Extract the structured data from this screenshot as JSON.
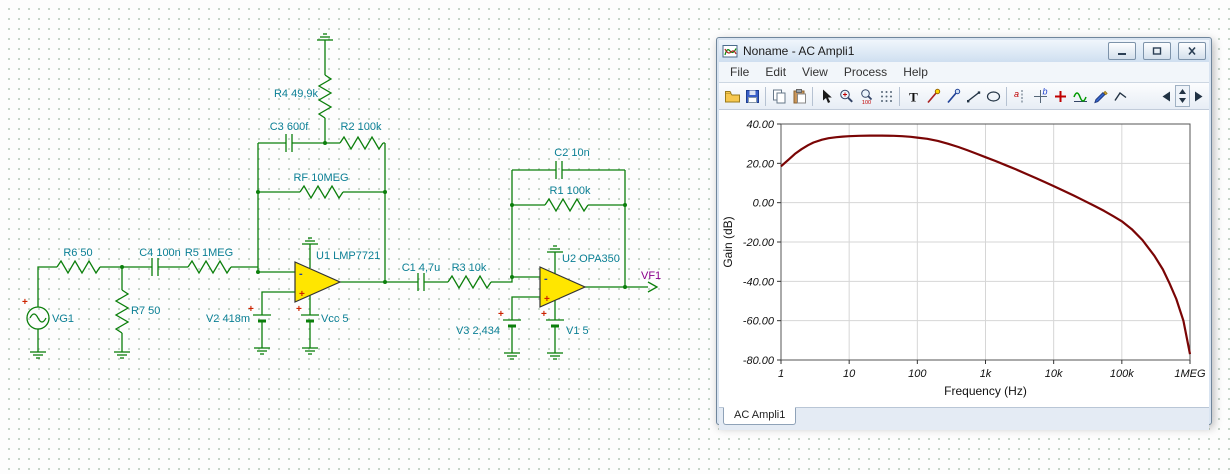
{
  "schematic": {
    "plus": "+",
    "minus": "-",
    "components": {
      "vg1": "VG1",
      "r6": "R6 50",
      "c4": "C4 100n",
      "r5": "R5 1MEG",
      "r7": "R7 50",
      "r4": "R4 49,9k",
      "c3": "C3 600f",
      "r2": "R2 100k",
      "rf": "RF 10MEG",
      "u1": "U1 LMP7721",
      "v2": "V2 418m",
      "vcc": "Vcc 5",
      "c1": "C1 4,7u",
      "r3": "R3 10k",
      "u2": "U2 OPA350",
      "c2": "C2 10n",
      "r1": "R1 100k",
      "v3": "V3 2,434",
      "v1": "V1 5",
      "vf1": "VF1"
    },
    "colors": {
      "wire": "#0c7f0c",
      "label": "#0b7f95",
      "output_label": "#8a008a",
      "opamp_fill": "#ffe600"
    }
  },
  "window": {
    "title": "Noname - AC Ampli1",
    "menu": [
      "File",
      "Edit",
      "View",
      "Process",
      "Help"
    ],
    "tab": "AC Ampli1",
    "toolbar_icons": [
      "open",
      "save",
      "copy",
      "paste",
      "select",
      "zoom-in",
      "zoom-100",
      "grid",
      "text",
      "probe-red",
      "probe-blue",
      "line",
      "ellipse",
      "cursor-a",
      "cursor-b",
      "add-marker",
      "waveform",
      "pen",
      "corner",
      "prev",
      "spinner",
      "next"
    ]
  },
  "toolbar": {
    "zoom_level_label": "100",
    "text_tool_label": "T",
    "cursor_a_label": "a",
    "cursor_b_label": "b"
  },
  "chart_data": {
    "type": "line",
    "title": "",
    "xlabel": "Frequency (Hz)",
    "ylabel": "Gain (dB)",
    "x_scale": "log",
    "xlim": [
      1,
      1000000
    ],
    "ylim": [
      -80,
      40
    ],
    "x_ticks": [
      "1",
      "10",
      "100",
      "1k",
      "10k",
      "100k",
      "1MEG"
    ],
    "x_tick_values": [
      1,
      10,
      100,
      1000,
      10000,
      100000,
      1000000
    ],
    "y_ticks": [
      "40.00",
      "20.00",
      "0.00",
      "-20.00",
      "-40.00",
      "-60.00",
      "-80.00"
    ],
    "y_tick_values": [
      40,
      20,
      0,
      -20,
      -40,
      -60,
      -80
    ],
    "grid": true,
    "legend": "none",
    "series": [
      {
        "name": "Gain",
        "color": "#7a0505",
        "points": [
          [
            1,
            18.5
          ],
          [
            1.3,
            22
          ],
          [
            1.6,
            24.8
          ],
          [
            2,
            27.2
          ],
          [
            2.5,
            29.2
          ],
          [
            3,
            30.6
          ],
          [
            4,
            32
          ],
          [
            5,
            32.8
          ],
          [
            6.5,
            33.3
          ],
          [
            8,
            33.6
          ],
          [
            10,
            33.8
          ],
          [
            14,
            34
          ],
          [
            20,
            34.1
          ],
          [
            30,
            34.1
          ],
          [
            45,
            34
          ],
          [
            60,
            33.8
          ],
          [
            80,
            33.5
          ],
          [
            100,
            33.1
          ],
          [
            140,
            32.5
          ],
          [
            200,
            31.4
          ],
          [
            280,
            30
          ],
          [
            400,
            28.3
          ],
          [
            550,
            26.6
          ],
          [
            750,
            24.8
          ],
          [
            1000,
            23.1
          ],
          [
            1400,
            21.2
          ],
          [
            2000,
            19
          ],
          [
            2800,
            16.9
          ],
          [
            4000,
            14.6
          ],
          [
            5500,
            12.5
          ],
          [
            7500,
            10.4
          ],
          [
            10000,
            8.4
          ],
          [
            14000,
            6.1
          ],
          [
            20000,
            3.5
          ],
          [
            28000,
            1
          ],
          [
            40000,
            -1.7
          ],
          [
            55000,
            -4.2
          ],
          [
            75000,
            -6.9
          ],
          [
            100000,
            -9.5
          ],
          [
            140000,
            -13.5
          ],
          [
            200000,
            -19
          ],
          [
            300000,
            -27
          ],
          [
            400000,
            -34
          ],
          [
            500000,
            -41
          ],
          [
            630000,
            -49
          ],
          [
            800000,
            -60
          ],
          [
            1000000,
            -77
          ]
        ]
      }
    ]
  }
}
